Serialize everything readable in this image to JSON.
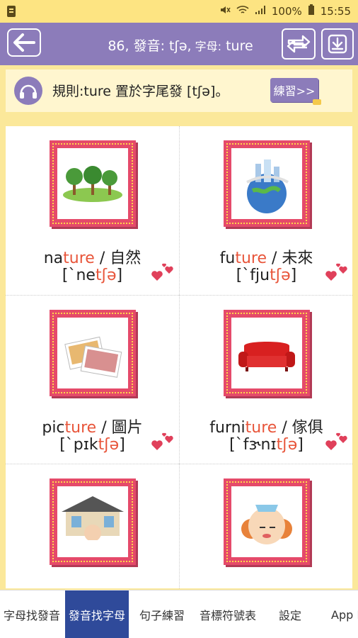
{
  "status": {
    "battery": "100%",
    "time": "15:55"
  },
  "header": {
    "title_prefix": "86, 發音: tʃə,",
    "title_small": " 字母:",
    "title_letters": " ture"
  },
  "rule": {
    "text": "規則:ture 置於字尾發 [tʃə]。",
    "practice_label": "練習>>"
  },
  "words": [
    {
      "pre": "na",
      "hl": "ture",
      "post": "",
      "meaning": " / 自然",
      "ipa_pre": "[ˋne",
      "ipa_hl": "tʃə",
      "ipa_post": "]"
    },
    {
      "pre": "fu",
      "hl": "ture",
      "post": "",
      "meaning": " / 未來",
      "ipa_pre": "[ˋfju",
      "ipa_hl": "tʃə",
      "ipa_post": "]"
    },
    {
      "pre": "pic",
      "hl": "ture",
      "post": "",
      "meaning": " / 圖片",
      "ipa_pre": "[ˋpɪk",
      "ipa_hl": "tʃə",
      "ipa_post": "]"
    },
    {
      "pre": "furni",
      "hl": "ture",
      "post": "",
      "meaning": " / 傢俱",
      "ipa_pre": "[ˋfɝnɪ",
      "ipa_hl": "tʃə",
      "ipa_post": "]"
    }
  ],
  "tabs": [
    "字母找發音",
    "發音找字母",
    "句子練習",
    "音標符號表",
    "設定",
    "App I"
  ]
}
